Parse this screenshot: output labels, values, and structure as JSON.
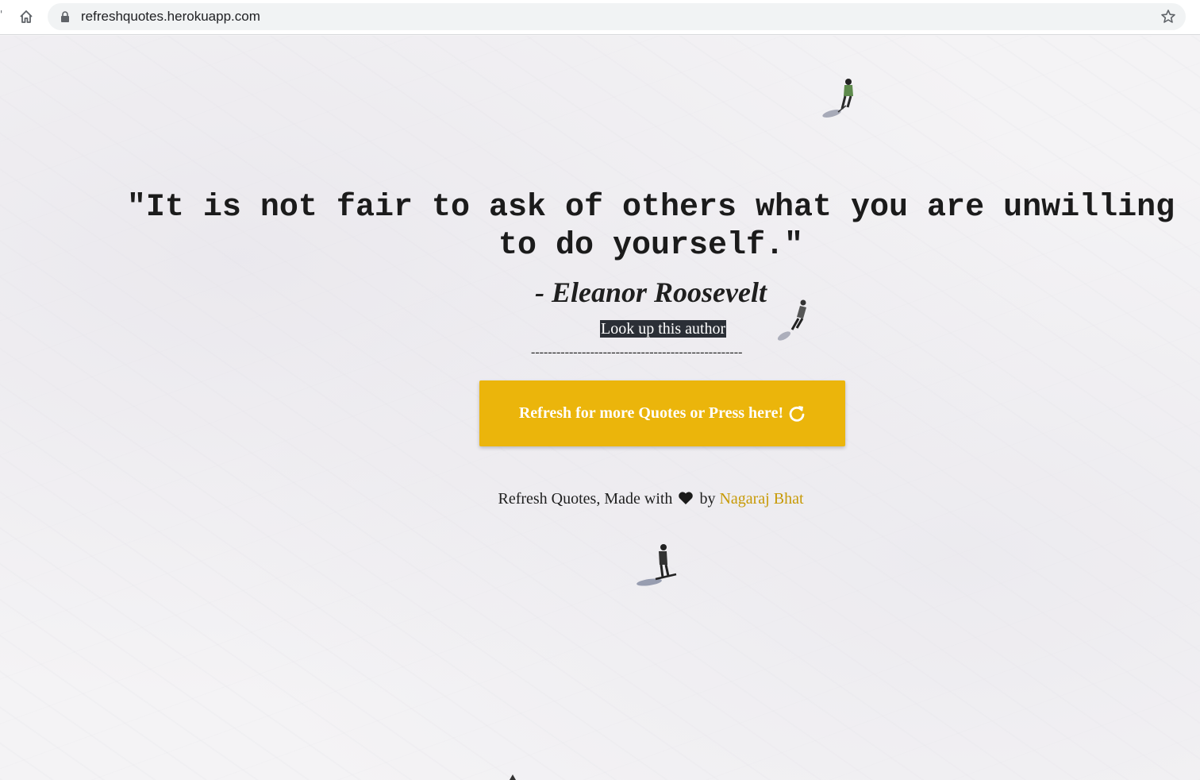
{
  "browser": {
    "url": "refreshquotes.herokuapp.com",
    "tab_edge": "'"
  },
  "quote": {
    "text": "\"It is not fair to ask of others what you are unwilling to do yourself.\"",
    "author": "- Eleanor Roosevelt",
    "lookup_label": "Look up this author",
    "divider": "--------------------------------------------------"
  },
  "refresh_button": {
    "label": "Refresh for more Quotes or Press here!",
    "icon": "refresh-icon"
  },
  "footer": {
    "prefix": "Refresh Quotes, Made with",
    "heart_icon": "heart-icon",
    "by": "by",
    "author_name": "Nagaraj Bhat"
  },
  "colors": {
    "button_bg": "#ebb50b",
    "link_color": "#c79a06",
    "lookup_bg": "#2b2f36",
    "page_bg": "#f4f3f5"
  }
}
